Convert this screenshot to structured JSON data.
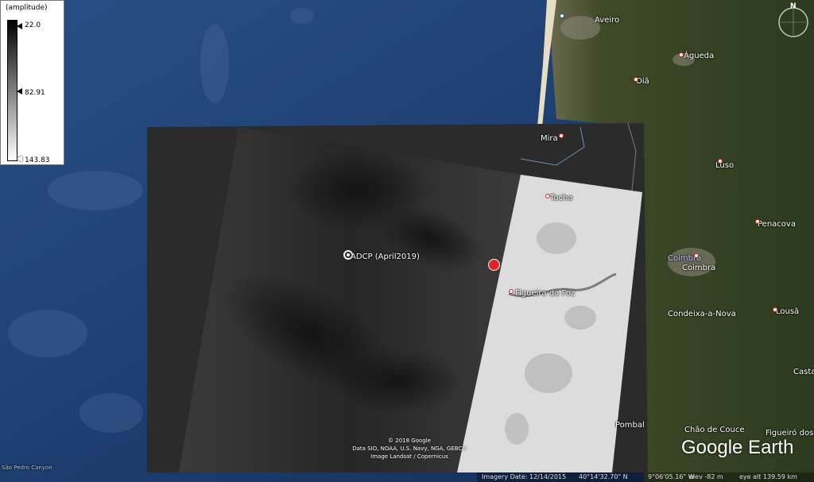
{
  "legend": {
    "title": "(amplitude)",
    "ticks": [
      {
        "label": "22.0",
        "fraction": 0.0
      },
      {
        "label": "82.91",
        "fraction": 0.5
      },
      {
        "label": "143.83",
        "fraction": 1.0
      }
    ]
  },
  "places": {
    "aveiro": "Aveiro",
    "agueda": "Águeda",
    "oia": "Oiã",
    "mira": "Mira",
    "luso": "Luso",
    "tocha": "Tocha",
    "penacova": "Penacova",
    "coimbra_blue": "Coimbra",
    "coimbra": "Coimbra",
    "figueira": "Figueira da Foz",
    "condeixa": "Condeixa-a-Nova",
    "lousa": "Lousã",
    "casta": "Casta",
    "pombal": "Pombal",
    "chao": "Chão de Couce",
    "figueiro": "Figueiró dos",
    "canyon": "São Pedro Canyon"
  },
  "poi": {
    "adcp": "ADCP (April2019)"
  },
  "credits": {
    "line1": "© 2018 Google",
    "line2": "Data SIO, NOAA, U.S. Navy, NGA, GEBCO",
    "line3": "Image Landsat / Copernicus"
  },
  "status": {
    "imagery_date": "Imagery Date: 12/14/2015",
    "lat": "40°14'32.70\" N",
    "lon": "9°06'05.16\" W",
    "elev": "elev  -82 m",
    "eye": "eye alt 139.59 km"
  },
  "brand": {
    "logo": "Google Earth"
  },
  "compass": {
    "north": "N"
  },
  "colors": {
    "ocean": "#1c3d6b",
    "land": "#3c4a2a",
    "sar_bg": "#2b2b2b",
    "pin_red": "#d2232a"
  }
}
